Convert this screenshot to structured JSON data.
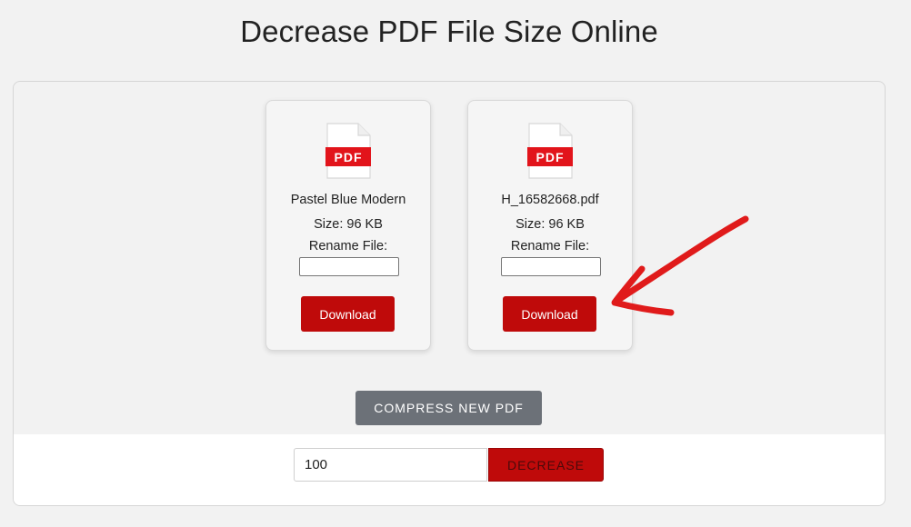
{
  "page": {
    "title": "Decrease PDF File Size Online"
  },
  "files": [
    {
      "icon_label": "PDF",
      "name": "Pastel Blue Modern",
      "size": "Size: 96 KB",
      "rename_label": "Rename File:",
      "rename_value": "",
      "download_label": "Download"
    },
    {
      "icon_label": "PDF",
      "name": "H_16582668.pdf",
      "size": "Size: 96 KB",
      "rename_label": "Rename File:",
      "rename_value": "",
      "download_label": "Download"
    }
  ],
  "actions": {
    "compress_new_label": "COMPRESS NEW PDF",
    "level_value": "100",
    "decrease_label": "DECREASE"
  },
  "colors": {
    "accent_red": "#bf0a0a",
    "compress_gray": "#6c7178",
    "annotation_red": "#e01b1b"
  },
  "icons": {
    "file": "pdf-file-icon",
    "annotation": "red-arrow-annotation-icon"
  }
}
